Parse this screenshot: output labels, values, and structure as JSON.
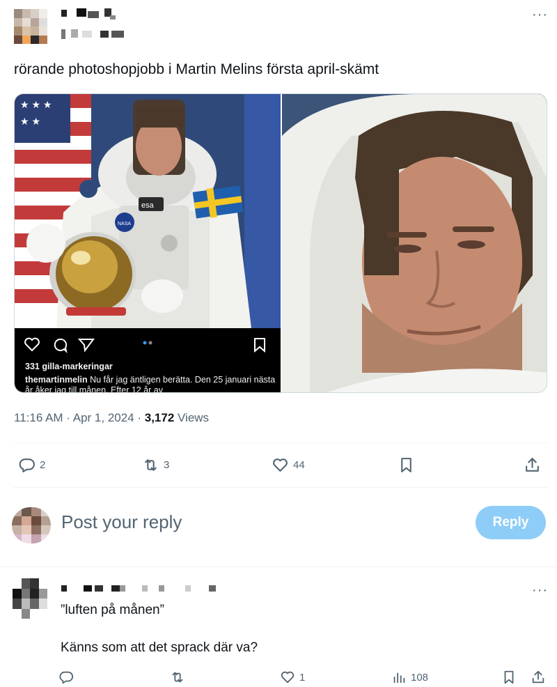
{
  "post": {
    "text": "rörande photoshopjobb i Martin Melins första april-skämt",
    "time": "11:16 AM · Apr 1, 2024 · ",
    "views_count": "3,172",
    "views_label": " Views",
    "media": {
      "instagram": {
        "likes": "331 gilla-markeringar",
        "caption_user": "themartinmelin",
        "caption_text": " Nu får jag äntligen berätta. Den 25 januari nästa år åker jag till månen. Efter 12 år av"
      }
    },
    "actions": {
      "replies": "2",
      "reposts": "3",
      "likes": "44"
    }
  },
  "reply_box": {
    "placeholder": "Post your reply",
    "button_label": "Reply"
  },
  "comment": {
    "quote": "”luften på månen”",
    "body": "Känns som att det sprack där va?",
    "actions": {
      "likes": "1",
      "views": "108"
    }
  },
  "colors": {
    "text_primary": "#0f1419",
    "text_secondary": "#536471",
    "reply_button": "#8ecdf8",
    "divider": "#eff3f4"
  }
}
